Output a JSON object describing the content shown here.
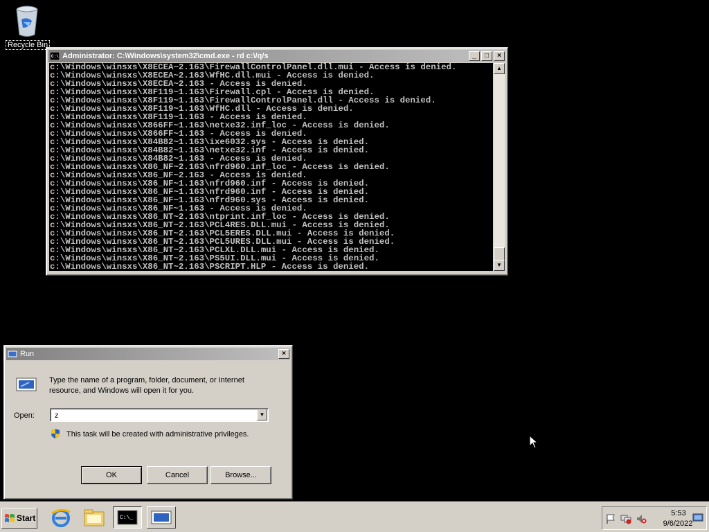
{
  "desktop": {
    "recycle_bin_label": "Recycle Bin"
  },
  "cmd_window": {
    "title": "Administrator: C:\\Windows\\system32\\cmd.exe - rd  c:\\/q/s",
    "lines": [
      "c:\\Windows\\winsxs\\X8ECEA~2.163\\FirewallControlPanel.dll.mui - Access is denied.",
      "c:\\Windows\\winsxs\\X8ECEA~2.163\\WfHC.dll.mui - Access is denied.",
      "c:\\Windows\\winsxs\\X8ECEA~2.163 - Access is denied.",
      "c:\\Windows\\winsxs\\X8F119~1.163\\Firewall.cpl - Access is denied.",
      "c:\\Windows\\winsxs\\X8F119~1.163\\FirewallControlPanel.dll - Access is denied.",
      "c:\\Windows\\winsxs\\X8F119~1.163\\WfHC.dll - Access is denied.",
      "c:\\Windows\\winsxs\\X8F119~1.163 - Access is denied.",
      "c:\\Windows\\winsxs\\X866FF~1.163\\netxe32.inf_loc - Access is denied.",
      "c:\\Windows\\winsxs\\X866FF~1.163 - Access is denied.",
      "c:\\Windows\\winsxs\\X84B82~1.163\\ixe6032.sys - Access is denied.",
      "c:\\Windows\\winsxs\\X84B82~1.163\\netxe32.inf - Access is denied.",
      "c:\\Windows\\winsxs\\X84B82~1.163 - Access is denied.",
      "c:\\Windows\\winsxs\\X86_NF~2.163\\nfrd960.inf_loc - Access is denied.",
      "c:\\Windows\\winsxs\\X86_NF~2.163 - Access is denied.",
      "c:\\Windows\\winsxs\\X86_NF~1.163\\nfrd960.inf - Access is denied.",
      "c:\\Windows\\winsxs\\X86_NF~1.163\\nfrd960.inf - Access is denied.",
      "c:\\Windows\\winsxs\\X86_NF~1.163\\nfrd960.sys - Access is denied.",
      "c:\\Windows\\winsxs\\X86_NF~1.163 - Access is denied.",
      "c:\\Windows\\winsxs\\X86_NT~2.163\\ntprint.inf_loc - Access is denied.",
      "c:\\Windows\\winsxs\\X86_NT~2.163\\PCL4RES.DLL.mui - Access is denied.",
      "c:\\Windows\\winsxs\\X86_NT~2.163\\PCL5ERES.DLL.mui - Access is denied.",
      "c:\\Windows\\winsxs\\X86_NT~2.163\\PCL5URES.DLL.mui - Access is denied.",
      "c:\\Windows\\winsxs\\X86_NT~2.163\\PCLXL.DLL.mui - Access is denied.",
      "c:\\Windows\\winsxs\\X86_NT~2.163\\PS5UI.DLL.mui - Access is denied.",
      "c:\\Windows\\winsxs\\X86_NT~2.163\\PSCRIPT.HLP - Access is denied."
    ]
  },
  "run_dialog": {
    "title": "Run",
    "description": "Type the name of a program, folder, document, or Internet resource, and Windows will open it for you.",
    "open_label": "Open:",
    "open_value": "z",
    "privilege_text": "This task will be created with administrative privileges.",
    "ok_label": "OK",
    "cancel_label": "Cancel",
    "browse_label": "Browse..."
  },
  "taskbar": {
    "start_label": "Start",
    "clock_time": "5:53",
    "clock_date": "9/6/2022"
  },
  "icons": {
    "recycle_bin": "recycle-bin-icon",
    "internet_explorer": "internet-explorer-icon",
    "explorer": "folder-icon",
    "cmd": "command-prompt-icon",
    "run": "run-icon",
    "shield": "uac-shield-icon"
  }
}
